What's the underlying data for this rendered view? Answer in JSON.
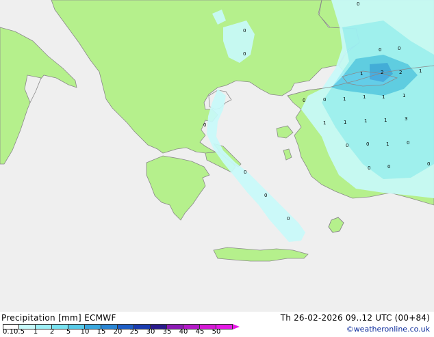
{
  "legend": {
    "title": "Precipitation [mm]  ECMWF",
    "valid": "Th 26-02-2026 09..12 UTC (00+84)",
    "credit": "©weatheronline.co.uk",
    "ticks": [
      "0.1",
      "0.5",
      "1",
      "2",
      "5",
      "10",
      "15",
      "20",
      "25",
      "30",
      "35",
      "40",
      "45",
      "50"
    ],
    "colors": [
      "#ffffff",
      "#c8fafa",
      "#9ef0f6",
      "#78e2f0",
      "#58cbe8",
      "#3aa8de",
      "#2a86d4",
      "#1e5ec6",
      "#1a3cb0",
      "#2a1a8c",
      "#8c1ab4",
      "#b41ac8",
      "#d41ad4",
      "#e61ae6"
    ]
  },
  "map": {
    "colors": {
      "land": "#b5f08c",
      "sea": "#efefef",
      "border": "#8a8a8a",
      "precip_light": "#c8fafa",
      "precip_med": "#9ef0f6",
      "precip_heavy": "#58cbe8"
    },
    "labels": [
      "0",
      "0",
      "0",
      "0",
      "0",
      "0",
      "0",
      "0",
      "0",
      "0",
      "0",
      "0",
      "0",
      "0",
      "0",
      "0",
      "0",
      "1",
      "1",
      "1",
      "1",
      "1",
      "1",
      "1",
      "1",
      "1",
      "1",
      "1",
      "2",
      "2",
      "3"
    ]
  }
}
